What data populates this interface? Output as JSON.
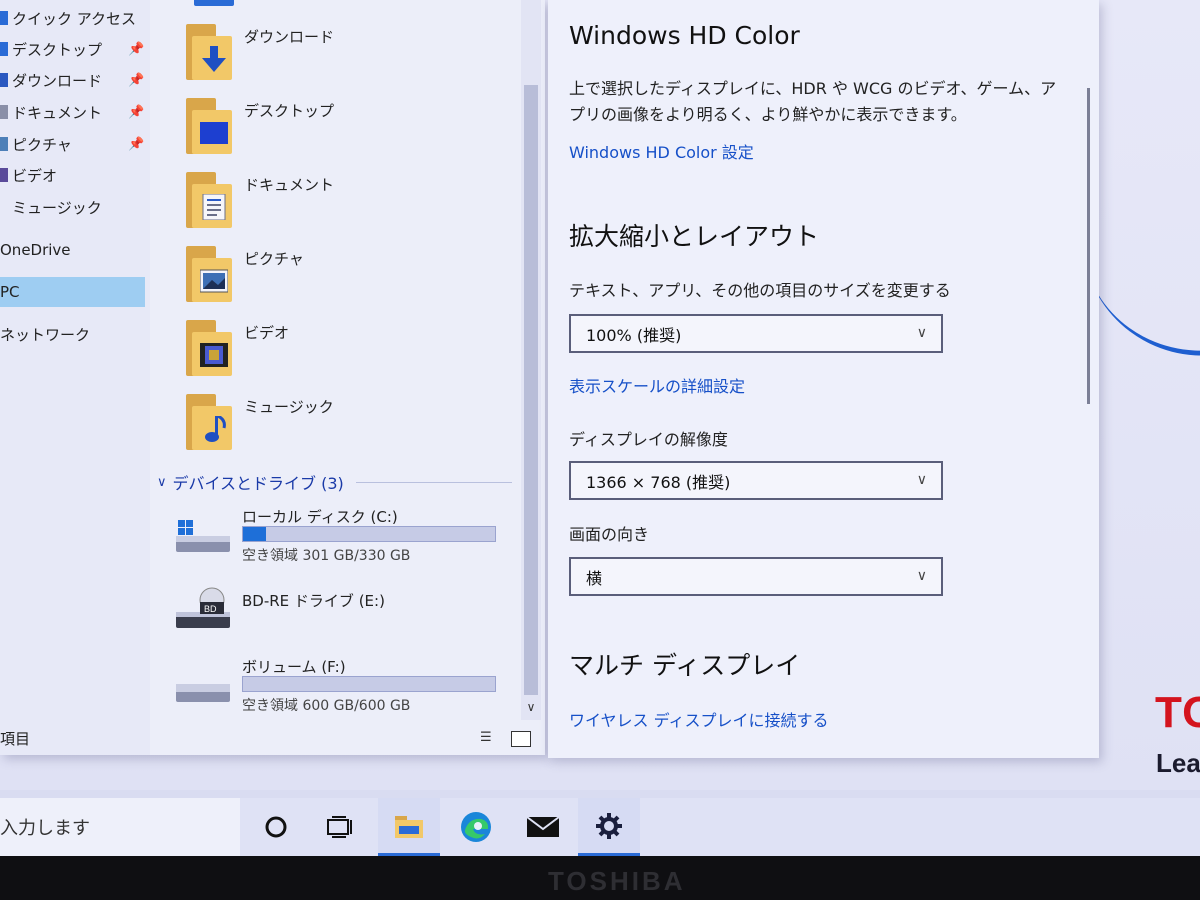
{
  "explorer": {
    "nav": [
      {
        "label": "クイック アクセス",
        "pinned": false
      },
      {
        "label": "デスクトップ",
        "pinned": true
      },
      {
        "label": "ダウンロード",
        "pinned": true
      },
      {
        "label": "ドキュメント",
        "pinned": true
      },
      {
        "label": "ピクチャ",
        "pinned": true
      },
      {
        "label": "ビデオ",
        "pinned": false
      },
      {
        "label": "ミュージック",
        "pinned": false
      },
      {
        "label": "OneDrive",
        "pinned": false
      },
      {
        "label": "PC",
        "pinned": false,
        "selected": true
      },
      {
        "label": "ネットワーク",
        "pinned": false
      }
    ],
    "folders": [
      {
        "label": "ダウンロード",
        "icon": "download-arrow-icon"
      },
      {
        "label": "デスクトップ",
        "icon": "desktop-icon"
      },
      {
        "label": "ドキュメント",
        "icon": "document-icon"
      },
      {
        "label": "ピクチャ",
        "icon": "picture-icon"
      },
      {
        "label": "ビデオ",
        "icon": "video-icon"
      },
      {
        "label": "ミュージック",
        "icon": "music-note-icon"
      }
    ],
    "devices_header": "デバイスとドライブ (3)",
    "drives": [
      {
        "name": "ローカル ディスク (C:)",
        "free": "空き領域 301 GB/330 GB",
        "used_fraction": 0.09,
        "icon": "windows-drive-icon"
      },
      {
        "name": "BD-RE ドライブ (E:)",
        "free": "",
        "icon": "bd-drive-icon"
      },
      {
        "name": "ボリューム (F:)",
        "free": "空き領域 600 GB/600 GB",
        "used_fraction": 0.0,
        "icon": "drive-icon"
      }
    ],
    "status_count": "項目"
  },
  "settings": {
    "hdr_heading": "Windows HD Color",
    "hdr_desc": "上で選択したディスプレイに、HDR や WCG のビデオ、ゲーム、アプリの画像をより明るく、より鮮やかに表示できます。",
    "hdr_link": "Windows HD Color 設定",
    "scale_heading": "拡大縮小とレイアウト",
    "scale_label": "テキスト、アプリ、その他の項目のサイズを変更する",
    "scale_value": "100% (推奨)",
    "scale_link": "表示スケールの詳細設定",
    "resolution_label": "ディスプレイの解像度",
    "resolution_value": "1366 × 768 (推奨)",
    "orientation_label": "画面の向き",
    "orientation_value": "横",
    "multi_heading": "マルチ ディスプレイ",
    "wireless_link": "ワイヤレス ディスプレイに接続する"
  },
  "taskbar": {
    "search_placeholder": "入力します",
    "buttons": [
      "cortana-icon",
      "task-view-icon",
      "file-explorer-icon",
      "edge-icon",
      "mail-icon",
      "settings-gear-icon"
    ]
  },
  "wallpaper": {
    "logo_text": "TO",
    "tag_text": "Lea"
  },
  "bezel_brand": "TOSHIBA",
  "colors": {
    "accent": "#1e6fd8",
    "link": "#1650c8",
    "selection": "#9ecdf2",
    "brand_red": "#d4141e"
  }
}
